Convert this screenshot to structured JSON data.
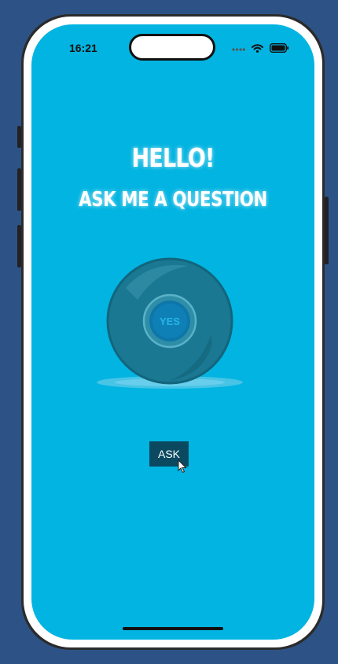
{
  "status_bar": {
    "time": "16:21",
    "icons": [
      "signal-icon",
      "wifi-icon",
      "battery-icon"
    ]
  },
  "main": {
    "greeting": "HELLO!",
    "prompt": "ASK ME A QUESTION",
    "answer": "YES",
    "ask_button_label": "ASK"
  },
  "colors": {
    "screen_background": "#02b4e1",
    "ball": "#1a7892",
    "button": "#0b4960",
    "page_background": "#2d5386"
  }
}
